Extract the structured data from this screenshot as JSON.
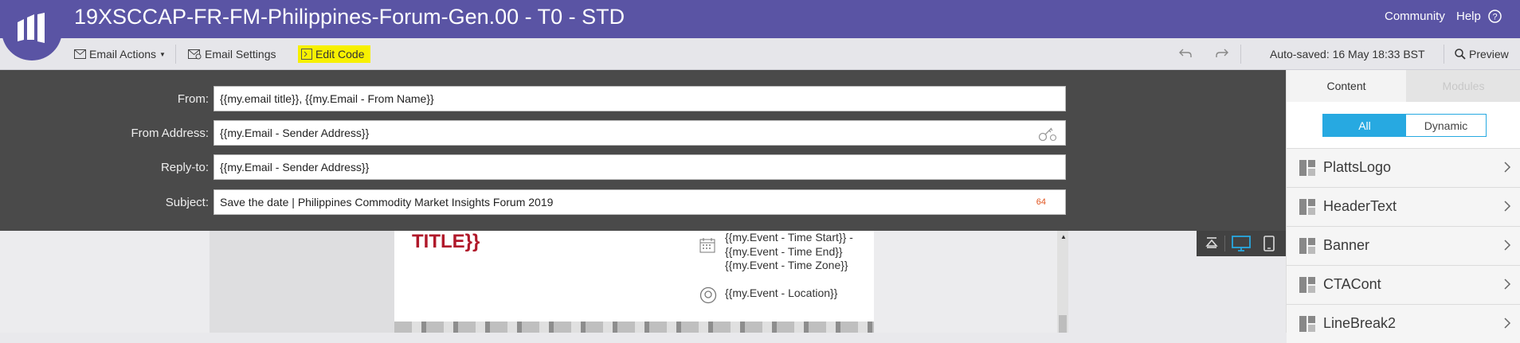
{
  "app": {
    "title": "19XSCCAP-FR-FM-Philippines-Forum-Gen.00 - T0 - STD",
    "top_links": {
      "community": "Community",
      "help": "Help"
    }
  },
  "toolbar": {
    "email_actions": "Email Actions",
    "email_settings": "Email Settings",
    "edit_code": "Edit Code",
    "autosaved": "Auto-saved: 16 May 18:33 BST",
    "preview": "Preview"
  },
  "headers": {
    "from": {
      "label": "From:",
      "value": "{{my.email title}}, {{my.Email - From Name}}"
    },
    "from_address": {
      "label": "From Address:",
      "value": "{{my.Email - Sender Address}}"
    },
    "reply_to": {
      "label": "Reply-to:",
      "value": "{{my.Email - Sender Address}}"
    },
    "subject": {
      "label": "Subject:",
      "value": "Save the date | Philippines Commodity Market Insights Forum 2019",
      "char_count": "64"
    }
  },
  "email_preview": {
    "title_fragment": "TITLE}}",
    "event_time": "{{my.Event - Time Start}} - {{my.Event - Time End}} {{my.Event - Time Zone}}",
    "event_location": "{{my.Event - Location}}"
  },
  "side_panel": {
    "tabs": {
      "content": "Content",
      "modules": "Modules"
    },
    "filter": {
      "all": "All",
      "dynamic": "Dynamic"
    },
    "modules": [
      "PlattsLogo",
      "HeaderText",
      "Banner",
      "CTACont",
      "LineBreak2"
    ]
  },
  "colors": {
    "brand": "#5a54a4",
    "highlight": "#f7f000",
    "accent": "#27a9e1",
    "title_red": "#b0182a"
  }
}
